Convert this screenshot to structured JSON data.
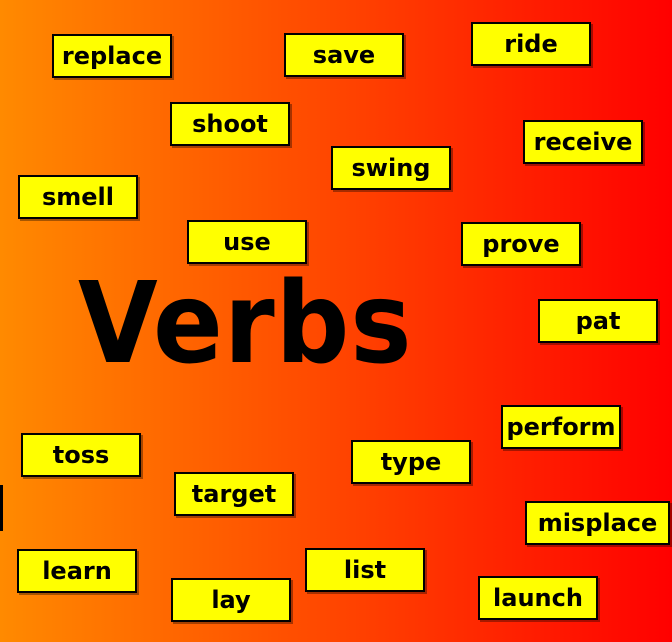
{
  "title": "Verbs",
  "words": [
    "replace",
    "save",
    "ride",
    "shoot",
    "receive",
    "swing",
    "smell",
    "use",
    "prove",
    "pat",
    "perform",
    "toss",
    "type",
    "target",
    "misplace",
    "learn",
    "list",
    "lay",
    "launch"
  ],
  "colors": {
    "card": "#ffff00",
    "text": "#000000",
    "bg_left": "#ff8a00",
    "bg_right": "#ff0000"
  }
}
